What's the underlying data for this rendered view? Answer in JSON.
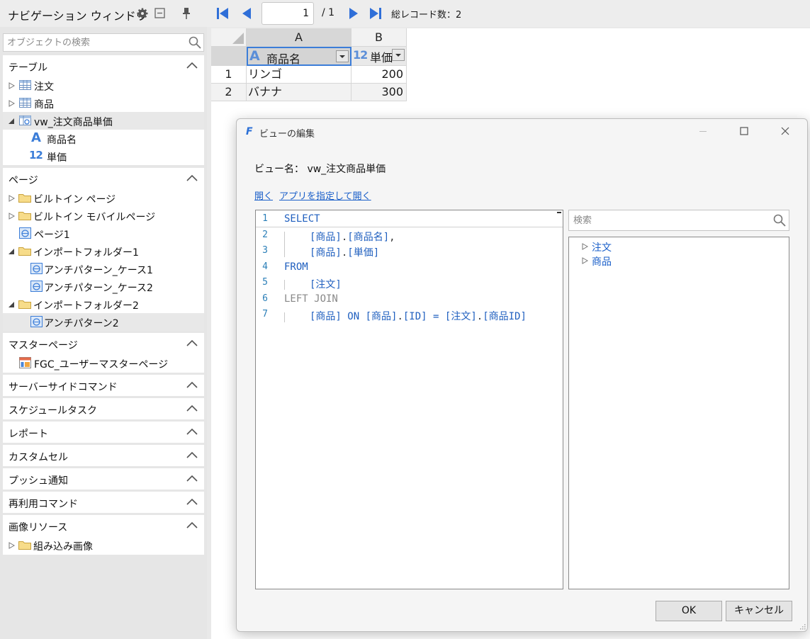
{
  "topbar": {
    "title": "ナビゲーション ウィンドウ",
    "page_value": "1",
    "page_total": "/ 1",
    "record_count": "総レコード数：2"
  },
  "left_panel": {
    "search_placeholder": "オブジェクトの検索",
    "sections": {
      "tables": {
        "title": "テーブル",
        "items": [
          "注文",
          "商品",
          "vw_注文商品単価"
        ],
        "fields": [
          "商品名",
          "単価"
        ]
      },
      "pages": {
        "title": "ページ",
        "items": [
          "ビルトイン ページ",
          "ビルトイン モバイルページ",
          "ページ1",
          "インポートフォルダー1",
          "アンチパターン_ケース1",
          "アンチパターン_ケース2",
          "インポートフォルダー2",
          "アンチパターン2"
        ]
      },
      "master_pages": {
        "title": "マスターページ",
        "items": [
          "FGC_ユーザーマスターページ"
        ]
      },
      "server_commands": {
        "title": "サーバーサイドコマンド"
      },
      "scheduled_tasks": {
        "title": "スケジュールタスク"
      },
      "reports": {
        "title": "レポート"
      },
      "custom_cells": {
        "title": "カスタムセル"
      },
      "push": {
        "title": "プッシュ通知"
      },
      "reusable_commands": {
        "title": "再利用コマンド"
      },
      "image_resources": {
        "title": "画像リソース",
        "items": [
          "組み込み画像"
        ]
      }
    }
  },
  "grid": {
    "col_letters": [
      "A",
      "B"
    ],
    "field_headers": [
      "商品名",
      "単価"
    ],
    "field_icons": [
      "A",
      "12"
    ],
    "rows": [
      {
        "num": "1",
        "name": "リンゴ",
        "price": "200"
      },
      {
        "num": "2",
        "name": "バナナ",
        "price": "300"
      }
    ]
  },
  "dialog": {
    "title": "ビューの編集",
    "view_name": "ビュー名：  vw_注文商品単価",
    "link_open": "開く",
    "link_open_with": "アプリを指定して開く",
    "search_placeholder": "検索",
    "tree": [
      "注文",
      "商品"
    ],
    "ok": "OK",
    "cancel": "キャンセル",
    "code": {
      "l1": "SELECT",
      "l2a": "[商品]",
      "l2b": ".",
      "l2c": "[商品名]",
      "l2d": ",",
      "l3a": "[商品]",
      "l3b": ".",
      "l3c": "[単価]",
      "l4": "FROM",
      "l5": "[注文]",
      "l6": "LEFT JOIN",
      "l7a": "[商品]",
      "l7b": " ON ",
      "l7c": "[商品]",
      "l7d": ".",
      "l7e": "[ID]",
      "l7f": " = ",
      "l7g": "[注文]",
      "l7h": ".",
      "l7i": "[商品ID]"
    }
  },
  "colors": {
    "accent": "#3b7dd8",
    "link": "#1a5fc9",
    "keyword": "#1f5fbf"
  }
}
